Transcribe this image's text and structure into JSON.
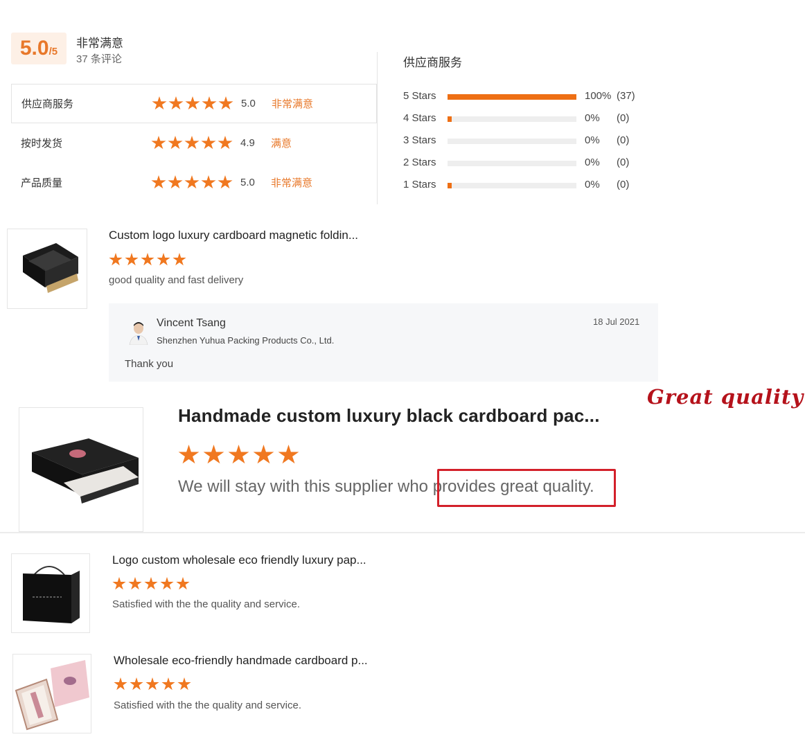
{
  "summary": {
    "score": "5.0",
    "score_max": "/5",
    "label": "非常满意",
    "review_count": "37 条评论"
  },
  "ratings": [
    {
      "label": "供应商服务",
      "stars": 5,
      "value": "5.0",
      "text": "非常满意"
    },
    {
      "label": "按时发货",
      "stars": 5,
      "value": "4.9",
      "text": "满意"
    },
    {
      "label": "产品质量",
      "stars": 5,
      "value": "5.0",
      "text": "非常满意"
    }
  ],
  "distribution": {
    "title": "供应商服务",
    "rows": [
      {
        "label": "5  Stars",
        "percent": 100,
        "pct_text": "100%",
        "count": "(37)"
      },
      {
        "label": "4  Stars",
        "percent": 3,
        "pct_text": "0%",
        "count": "(0)"
      },
      {
        "label": "3  Stars",
        "percent": 0,
        "pct_text": "0%",
        "count": "(0)"
      },
      {
        "label": "2  Stars",
        "percent": 0,
        "pct_text": "0%",
        "count": "(0)"
      },
      {
        "label": "1  Stars",
        "percent": 3,
        "pct_text": "0%",
        "count": "(0)"
      }
    ]
  },
  "reviews": [
    {
      "title": "Custom logo luxury cardboard magnetic foldin...",
      "stars": 5,
      "text": "good quality and fast delivery"
    },
    {
      "title": "Handmade custom luxury black cardboard pac...",
      "stars": 5,
      "text": "We will stay with this supplier who provides great quality."
    },
    {
      "title": "Logo custom wholesale eco friendly luxury pap...",
      "stars": 5,
      "text": "Satisfied with the the quality and service."
    },
    {
      "title": "Wholesale eco-friendly handmade cardboard p...",
      "stars": 5,
      "text": "Satisfied with the the quality and service."
    }
  ],
  "reply": {
    "name": "Vincent Tsang",
    "company": "Shenzhen Yuhua Packing Products Co., Ltd.",
    "date": "18 Jul 2021",
    "text": "Thank you"
  },
  "badge": "Great quality",
  "colors": {
    "accent": "#f07820",
    "highlight_border": "#d3202a",
    "badge": "#b5121b"
  }
}
